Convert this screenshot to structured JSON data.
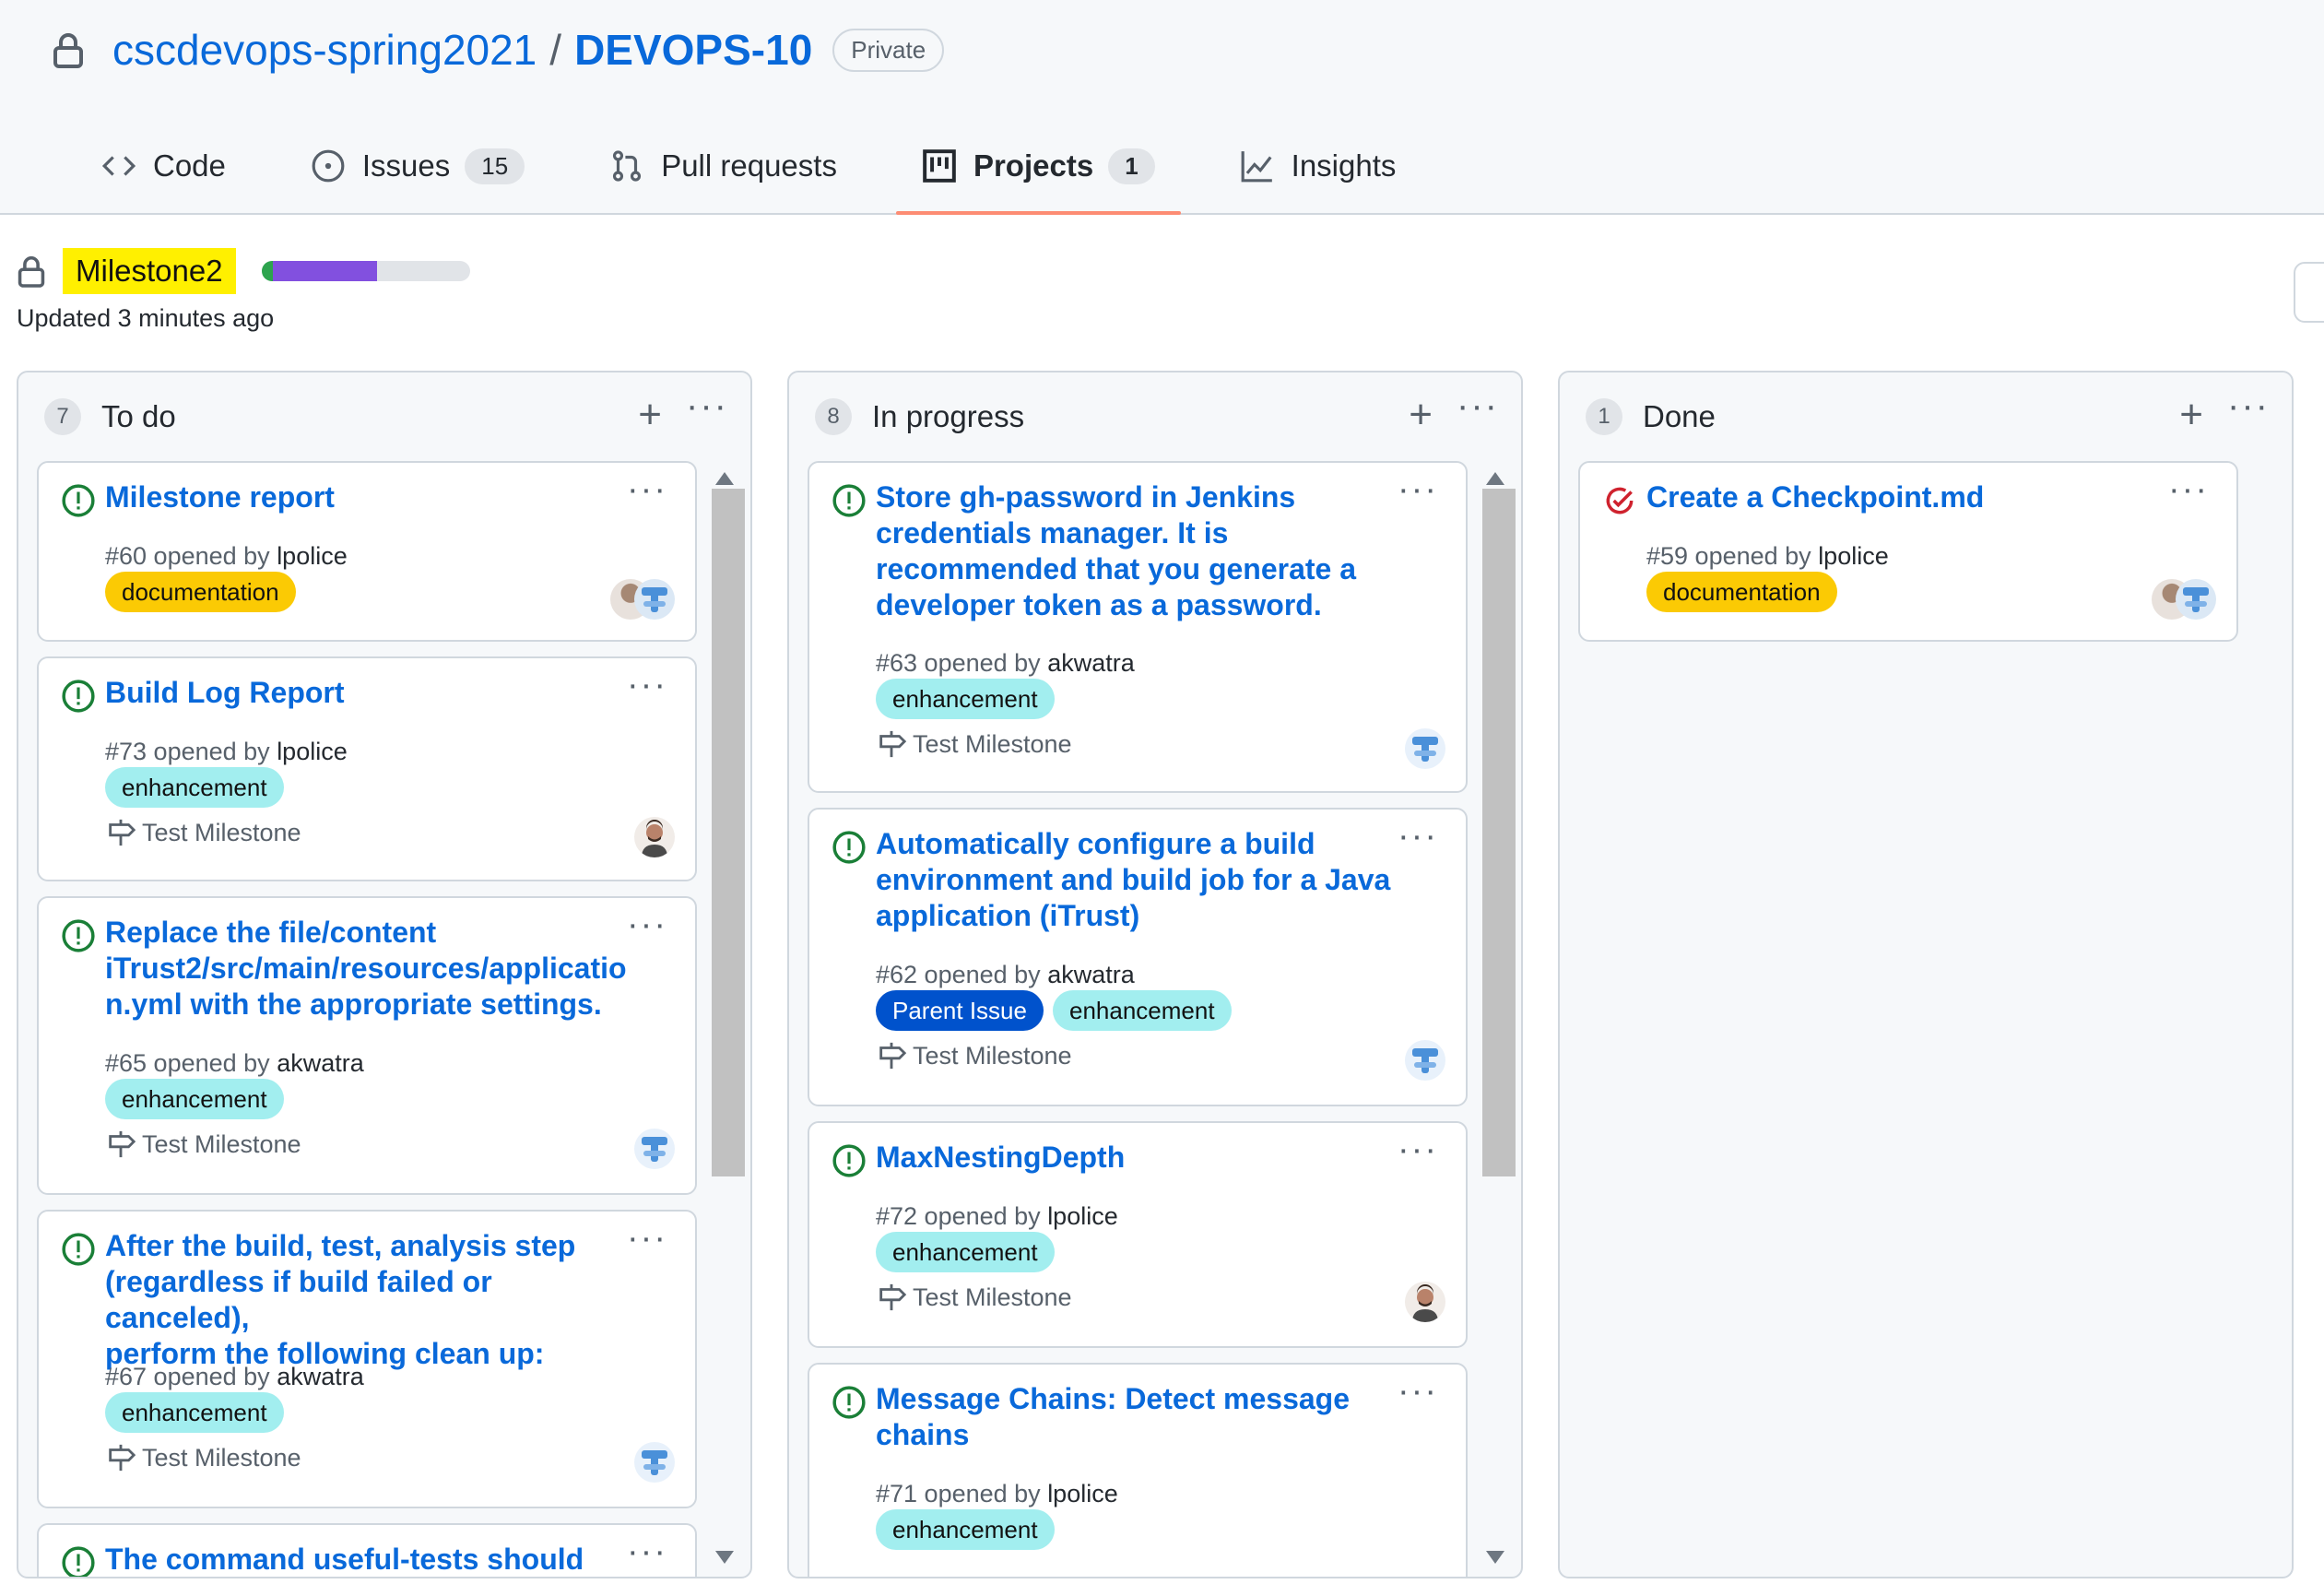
{
  "repo": {
    "owner": "cscdevops-spring2021",
    "separator": "/",
    "name": "DEVOPS-10",
    "visibility": "Private"
  },
  "tabs": [
    {
      "label": "Code",
      "icon": "code-icon"
    },
    {
      "label": "Issues",
      "icon": "issue-icon",
      "count": "15"
    },
    {
      "label": "Pull requests",
      "icon": "pull-request-icon"
    },
    {
      "label": "Projects",
      "icon": "project-icon",
      "count": "1",
      "active": true
    },
    {
      "label": "Insights",
      "icon": "graph-icon"
    }
  ],
  "project": {
    "name": "Milestone2",
    "updated": "Updated 3 minutes ago",
    "progress": {
      "done_fraction": 0.056,
      "in_progress_fraction": 0.5
    },
    "colors": {
      "done": "#2da44e",
      "in_progress": "#8250df",
      "highlight": "#fff000"
    }
  },
  "columns": [
    {
      "title": "To do",
      "count": "7",
      "cards": [
        {
          "title": "Milestone report",
          "meta_prefix": "#60 opened by",
          "author": "lpolice",
          "labels": [
            "documentation"
          ],
          "milestone": ""
        },
        {
          "title": "Build Log Report",
          "meta_prefix": "#73 opened by",
          "author": "lpolice",
          "labels": [
            "enhancement"
          ],
          "milestone": "Test Milestone"
        },
        {
          "title_lines": [
            "Replace the file/content",
            "iTrust2/src/main/resources/applicatio",
            "n.yml with the appropriate settings."
          ],
          "meta_prefix": "#65 opened by",
          "author": "akwatra",
          "labels": [
            "enhancement"
          ],
          "milestone": "Test Milestone"
        },
        {
          "title_lines": [
            "After the build, test, analysis step",
            "(regardless if build failed or canceled),",
            "perform the following clean up:"
          ],
          "meta_prefix": "#67 opened by",
          "author": "akwatra",
          "labels": [
            "enhancement"
          ],
          "milestone": "Test Milestone"
        },
        {
          "title": "The command useful-tests should be"
        }
      ]
    },
    {
      "title": "In progress",
      "count": "8",
      "cards": [
        {
          "title_lines": [
            "Store gh-password in Jenkins",
            "credentials manager. It is",
            "recommended that you generate a",
            "developer token as a password."
          ],
          "meta_prefix": "#63 opened by",
          "author": "akwatra",
          "labels": [
            "enhancement"
          ],
          "milestone": "Test Milestone"
        },
        {
          "title_lines": [
            "Automatically configure a build",
            "environment and build job for a Java",
            "application (iTrust)"
          ],
          "meta_prefix": "#62 opened by",
          "author": "akwatra",
          "labels": [
            "Parent Issue",
            "enhancement"
          ],
          "milestone": "Test Milestone"
        },
        {
          "title": "MaxNestingDepth",
          "meta_prefix": "#72 opened by",
          "author": "lpolice",
          "labels": [
            "enhancement"
          ],
          "milestone": "Test Milestone"
        },
        {
          "title_lines": [
            "Message Chains: Detect message",
            "chains"
          ],
          "meta_prefix": "#71 opened by",
          "author": "lpolice",
          "labels": [
            "enhancement"
          ],
          "milestone": ""
        }
      ]
    },
    {
      "title": "Done",
      "count": "1",
      "cards": [
        {
          "title": "Create a Checkpoint.md",
          "meta_prefix": "#59 opened by",
          "author": "lpolice",
          "labels": [
            "documentation"
          ],
          "milestone": ""
        }
      ]
    }
  ],
  "more_glyph": "···",
  "plus_glyph": "+"
}
